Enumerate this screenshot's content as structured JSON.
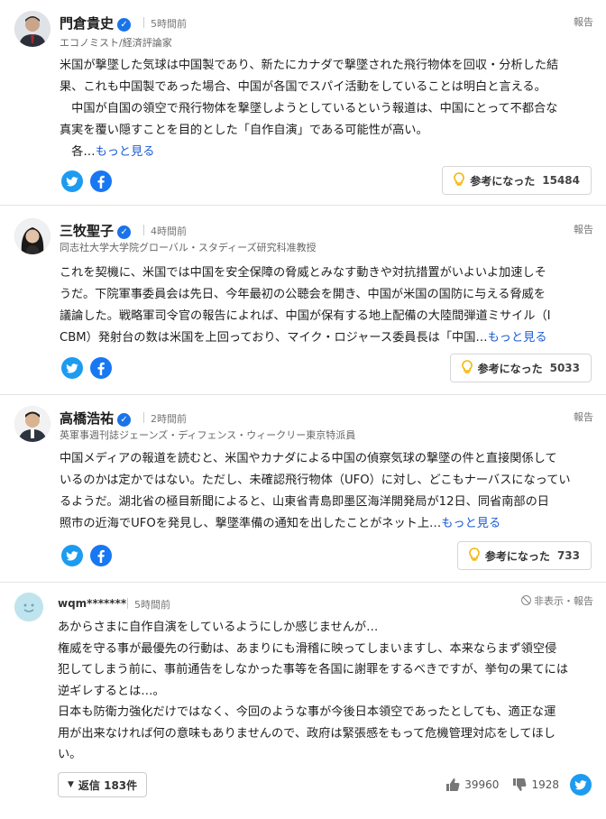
{
  "expert_comments": [
    {
      "name": "門倉貴史",
      "time": "5時間前",
      "title": "エコノミスト/経済評論家",
      "report": "報告",
      "lines": [
        "米国が撃墜した気球は中国製であり、新たにカナダで撃墜された飛行物体を回収・分析した結",
        "果、これも中国製であった場合、中国が各国でスパイ活動をしていることは明白と言える。",
        "　中国が自国の領空で飛行物体を撃墜しようとしているという報道は、中国にとって不都合な",
        "真実を覆い隠すことを目的とした「自作自演」である可能性が高い。",
        "　各…"
      ],
      "more": "もっと見る",
      "helpful_label": "参考になった",
      "helpful_count": "15484"
    },
    {
      "name": "三牧聖子",
      "time": "4時間前",
      "title": "同志社大学大学院グローバル・スタディーズ研究科准教授",
      "report": "報告",
      "lines": [
        "これを契機に、米国では中国を安全保障の脅威とみなす動きや対抗措置がいよいよ加速しそ",
        "うだ。下院軍事委員会は先日、今年最初の公聴会を開き、中国が米国の国防に与える脅威を",
        "議論した。戦略軍司令官の報告によれば、中国が保有する地上配備の大陸間弾道ミサイル（I",
        "CBM）発射台の数は米国を上回っており、マイク・ロジャース委員長は「中国…"
      ],
      "more": "もっと見る",
      "helpful_label": "参考になった",
      "helpful_count": "5033"
    },
    {
      "name": "高橋浩祐",
      "time": "2時間前",
      "title": "英軍事週刊誌ジェーンズ・ディフェンス・ウィークリー東京特派員",
      "report": "報告",
      "lines": [
        "中国メディアの報道を読むと、米国やカナダによる中国の偵察気球の撃墜の件と直接関係して",
        "いるのかは定かではない。ただし、未確認飛行物体（UFO）に対し、どこもナーバスになってい",
        "るようだ。湖北省の極目新聞によると、山東省青島即墨区海洋開発局が12日、同省南部の日",
        "照市の近海でUFOを発見し、撃墜準備の通知を出したことがネット上…"
      ],
      "more": "もっと見る",
      "helpful_label": "参考になった",
      "helpful_count": "733"
    }
  ],
  "user_comment": {
    "name": "wqm*******",
    "time": "5時間前",
    "hide_report": "非表示・報告",
    "lines": [
      "あからさまに自作自演をしているようにしか感じませんが…",
      "権威を守る事が最優先の行動は、あまりにも滑稽に映ってしまいますし、本来ならまず領空侵",
      "犯してしまう前に、事前通告をしなかった事等を各国に謝罪をするべきですが、挙句の果てには",
      "逆ギレするとは…。",
      "日本も防衛力強化だけではなく、今回のような事が今後日本領空であったとしても、適正な運",
      "用が出来なければ何の意味もありませんので、政府は緊張感をもって危機管理対応をしてほし",
      "い。"
    ],
    "reply_label": "返信 183件",
    "likes": "39960",
    "dislikes": "1928"
  },
  "colors": {
    "link": "#1a5dd6",
    "twitter": "#1d9bf0",
    "facebook": "#1877f2",
    "verified": "#1a73e8",
    "bulb": "#f4b400"
  },
  "icons": [
    "twitter-icon",
    "facebook-icon",
    "lightbulb-icon",
    "verified-icon",
    "thumbs-up-icon",
    "thumbs-down-icon",
    "hide-icon"
  ]
}
